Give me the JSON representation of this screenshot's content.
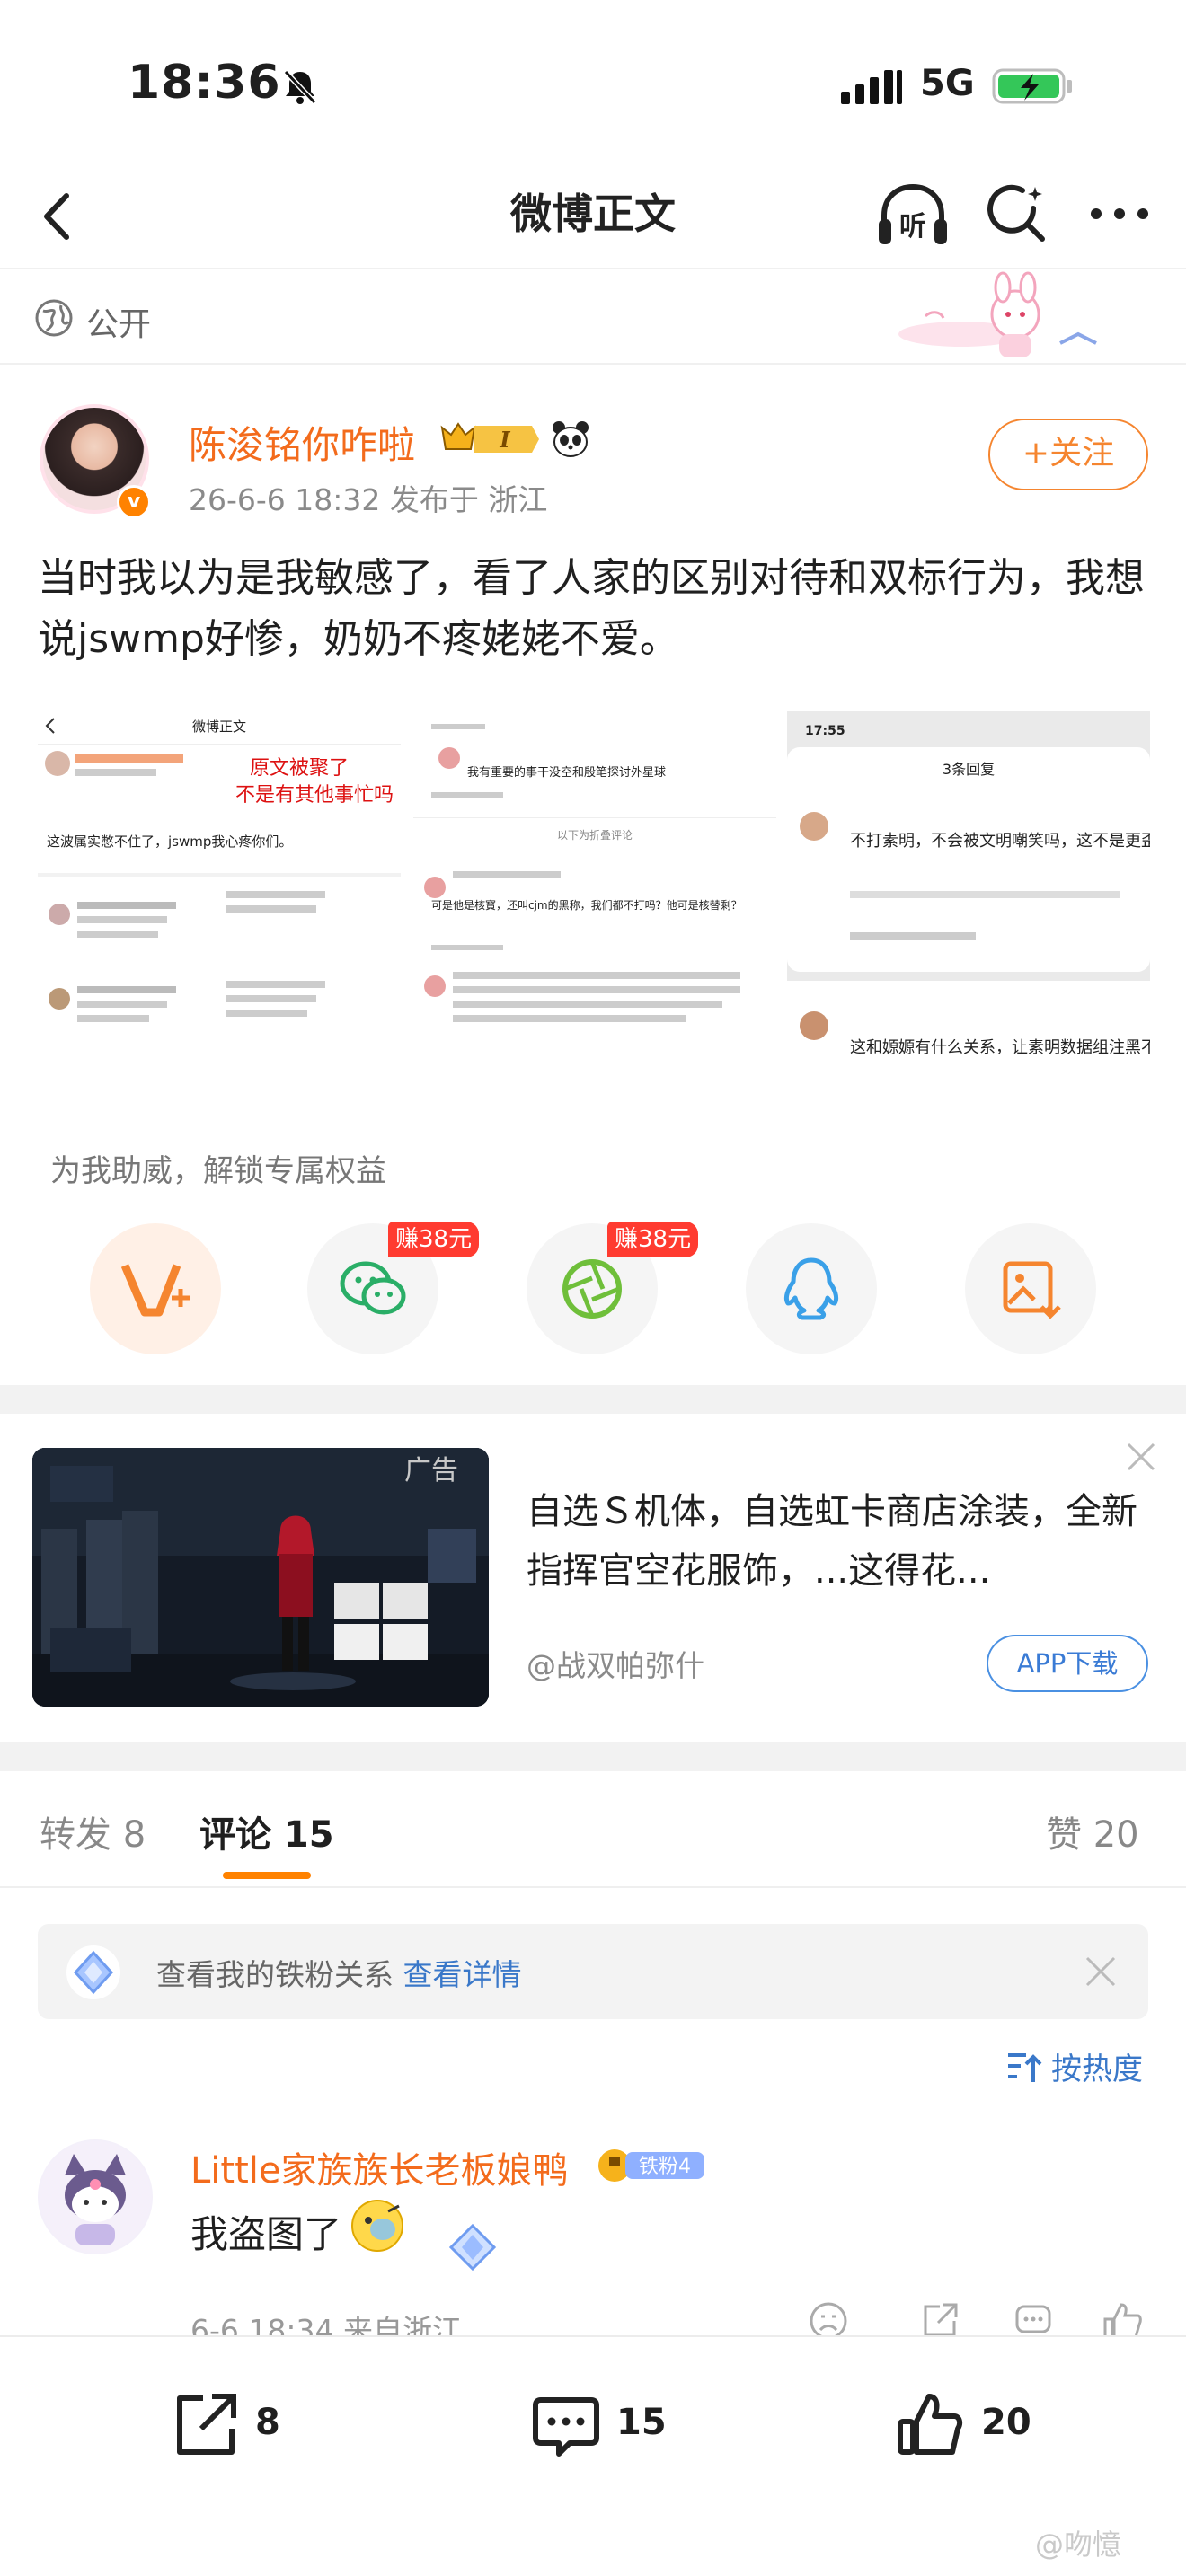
{
  "status_bar": {
    "time": "18:36",
    "network": "5G"
  },
  "nav": {
    "title": "微博正文",
    "listen_label": "听"
  },
  "post": {
    "visibility": "公开",
    "author": {
      "name": "陈浚铭你咋啦",
      "vip_level": "I",
      "verified_mark": "v"
    },
    "meta": "26-6-6 18:32  发布于 浙江",
    "follow_label": "+关注",
    "text": "当时我以为是我敏感了，看了人家的区别对待和双标行为，我想说jswmp好惨，奶奶不疼姥姥不爱。",
    "images": {
      "img1": {
        "nav_title": "微博正文",
        "overlay_line1": "原文被聚了",
        "overlay_line2": "不是有其他事忙吗",
        "post_snippet": "这波属实憋不住了，jswmp我心疼你们。"
      },
      "img2": {
        "line1": "我有重要的事干没空和殷笔探讨外星球",
        "line2": "以下为折叠评论",
        "line3": "可是他是核寳，还叫cjm的黑称，我们都不打吗？他可是核替剩？"
      },
      "img3": {
        "time": "17:55",
        "header": "3条回复",
        "reply1": "不打素明，不会被文明嘲笑吗，这不是更歪屁股吗，为什么不带领着屠超话了",
        "reply2": "这和嫄嫄有什么关系，让素明数据组注黑不就行了(卷里，我是"
      }
    }
  },
  "boost": {
    "label": "为我助威，解锁专属权益",
    "earn_badge_1": "赚38元",
    "earn_badge_2": "赚38元"
  },
  "ad": {
    "tag": "广告",
    "title": "自选Ｓ机体，自选虹卡商店涂装，全新指挥官空花服饰，...这得花...",
    "source": "@战双帕弥什",
    "download_label": "APP下载"
  },
  "tabs": {
    "repost": "转发 8",
    "comments": "评论 15",
    "likes": "赞 20"
  },
  "fan_banner": {
    "text": "查看我的铁粉关系",
    "link": "查看详情"
  },
  "sort": {
    "label": "按热度"
  },
  "comment": {
    "name": "Little家族族长老板娘鸭",
    "fan_badge": "铁粉4",
    "text": "我盗图了",
    "meta": "6-6 18:34  来自浙江"
  },
  "bottom_bar": {
    "repost_count": "8",
    "comment_count": "15",
    "like_count": "20"
  },
  "watermark": "@吻憶",
  "colors": {
    "accent_orange": "#ff8200",
    "name_orange": "#f36b1c",
    "link_blue": "#3a78c9",
    "earn_red": "#ff3b30"
  }
}
